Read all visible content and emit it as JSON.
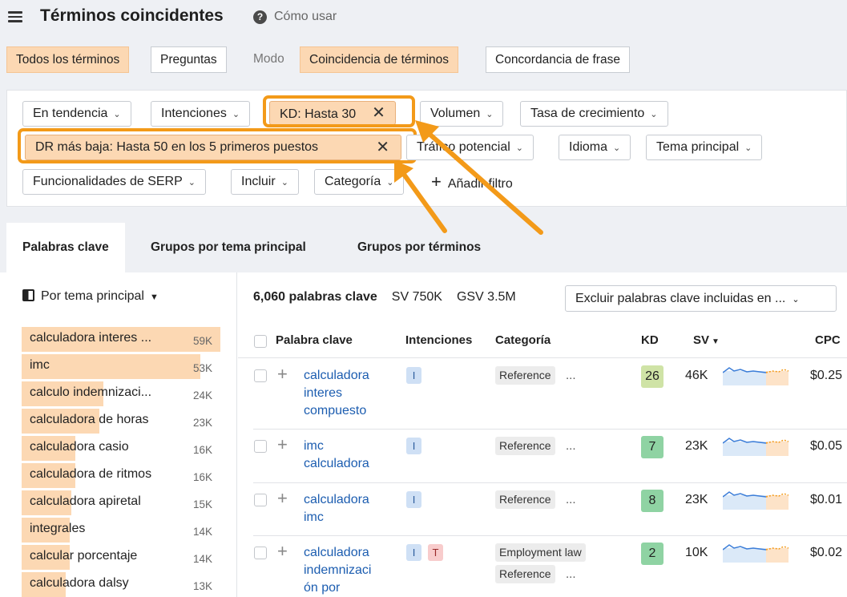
{
  "header": {
    "title": "Términos coincidentes",
    "help_label": "Cómo usar"
  },
  "term_tabs": [
    "Todos los términos",
    "Preguntas"
  ],
  "mode": {
    "label": "Modo",
    "options": [
      "Coincidencia de términos",
      "Concordancia de frase"
    ]
  },
  "filters": {
    "row1": [
      "En tendencia",
      "Intenciones",
      "KD: Hasta 30",
      "Volumen",
      "Tasa de crecimiento"
    ],
    "row2": [
      "DR más baja: Hasta 50 en los 5 primeros puestos",
      "Tráfico potencial",
      "Idioma",
      "Tema principal"
    ],
    "row3": [
      "Funcionalidades de SERP",
      "Incluir",
      "Categoría",
      "Añadir filtro"
    ]
  },
  "result_tabs": [
    "Palabras clave",
    "Grupos por tema principal",
    "Grupos por términos"
  ],
  "sidebar": {
    "heading": "Por tema principal",
    "items": [
      {
        "label": "calculadora interes ...",
        "count": "59K",
        "share": 1.0
      },
      {
        "label": "imc",
        "count": "53K",
        "share": 0.9
      },
      {
        "label": "calculo indemnizaci...",
        "count": "24K",
        "share": 0.41
      },
      {
        "label": "calculadora de horas",
        "count": "23K",
        "share": 0.39
      },
      {
        "label": "calculadora casio",
        "count": "16K",
        "share": 0.27
      },
      {
        "label": "calculadora de ritmos",
        "count": "16K",
        "share": 0.27
      },
      {
        "label": "calculadora apiretal",
        "count": "15K",
        "share": 0.25
      },
      {
        "label": "integrales",
        "count": "14K",
        "share": 0.24
      },
      {
        "label": "calcular porcentaje",
        "count": "14K",
        "share": 0.24
      },
      {
        "label": "calculadora dalsy",
        "count": "13K",
        "share": 0.22
      }
    ]
  },
  "summary": {
    "keywords": "6,060 palabras clave",
    "sv": "SV 750K",
    "gsv": "GSV 3.5M",
    "exclude_label": "Excluir palabras clave incluidas en ..."
  },
  "table": {
    "headers": [
      "Palabra clave",
      "Intenciones",
      "Categoría",
      "KD",
      "SV",
      "CPC"
    ],
    "rows": [
      {
        "keyword_lines": [
          "calculadora",
          "interes",
          "compuesto"
        ],
        "intents": [
          "I"
        ],
        "categories": [
          "Reference"
        ],
        "kd": "26",
        "sv": "46K",
        "cpc": "$0.25",
        "kd_color": "#cfe3a6"
      },
      {
        "keyword_lines": [
          "imc",
          "calculadora"
        ],
        "intents": [
          "I"
        ],
        "categories": [
          "Reference"
        ],
        "kd": "7",
        "sv": "23K",
        "cpc": "$0.05",
        "kd_color": "#8fd3a3"
      },
      {
        "keyword_lines": [
          "calculadora",
          "imc"
        ],
        "intents": [
          "I"
        ],
        "categories": [
          "Reference"
        ],
        "kd": "8",
        "sv": "23K",
        "cpc": "$0.01",
        "kd_color": "#8fd3a3"
      },
      {
        "keyword_lines": [
          "calculadora",
          "indemnizaci",
          "ón por"
        ],
        "intents": [
          "I",
          "T"
        ],
        "categories": [
          "Employment law",
          "Reference"
        ],
        "kd": "2",
        "sv": "10K",
        "cpc": "$0.02",
        "kd_color": "#8fd3a3"
      }
    ]
  },
  "ellipsis": "..."
}
